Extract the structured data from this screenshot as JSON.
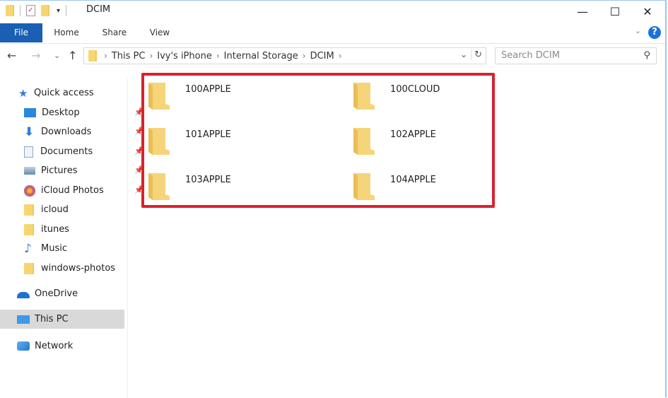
{
  "window": {
    "title": "DCIM",
    "minimize_label": "—",
    "maximize_label": "☐",
    "close_label": "✕"
  },
  "ribbon": {
    "tabs": [
      {
        "label": "File"
      },
      {
        "label": "Home"
      },
      {
        "label": "Share"
      },
      {
        "label": "View"
      }
    ],
    "help_label": "?",
    "expand_label": "⌄"
  },
  "nav": {
    "back": "←",
    "forward": "→",
    "recent": "⌄",
    "up": "↑",
    "breadcrumb": [
      "This PC",
      "Ivy's iPhone",
      "Internal Storage",
      "DCIM"
    ],
    "search_placeholder": "Search DCIM"
  },
  "sidebar": {
    "items": [
      {
        "label": "Quick access",
        "icon": "star-icon",
        "pinned": false
      },
      {
        "label": "Desktop",
        "icon": "desktop-icon",
        "pinned": true
      },
      {
        "label": "Downloads",
        "icon": "download-icon",
        "pinned": true
      },
      {
        "label": "Documents",
        "icon": "documents-icon",
        "pinned": true
      },
      {
        "label": "Pictures",
        "icon": "pictures-icon",
        "pinned": true
      },
      {
        "label": "iCloud Photos",
        "icon": "icloud-photos-icon",
        "pinned": true
      },
      {
        "label": "icloud",
        "icon": "folder-icon",
        "pinned": false
      },
      {
        "label": "itunes",
        "icon": "folder-icon",
        "pinned": false
      },
      {
        "label": "Music",
        "icon": "music-icon",
        "pinned": false
      },
      {
        "label": "windows-photos",
        "icon": "folder-icon",
        "pinned": false
      },
      {
        "label": "OneDrive",
        "icon": "onedrive-icon",
        "pinned": false
      },
      {
        "label": "This PC",
        "icon": "this-pc-icon",
        "pinned": false,
        "selected": true
      },
      {
        "label": "Network",
        "icon": "network-icon",
        "pinned": false
      }
    ]
  },
  "content": {
    "folders": [
      {
        "name": "100APPLE"
      },
      {
        "name": "100CLOUD"
      },
      {
        "name": "101APPLE"
      },
      {
        "name": "102APPLE"
      },
      {
        "name": "103APPLE"
      },
      {
        "name": "104APPLE"
      }
    ],
    "highlight_color": "#d9222f"
  },
  "colors": {
    "accent": "#1a5fb4",
    "folder": "#f7d66f",
    "selection": "#d9d9d9"
  }
}
